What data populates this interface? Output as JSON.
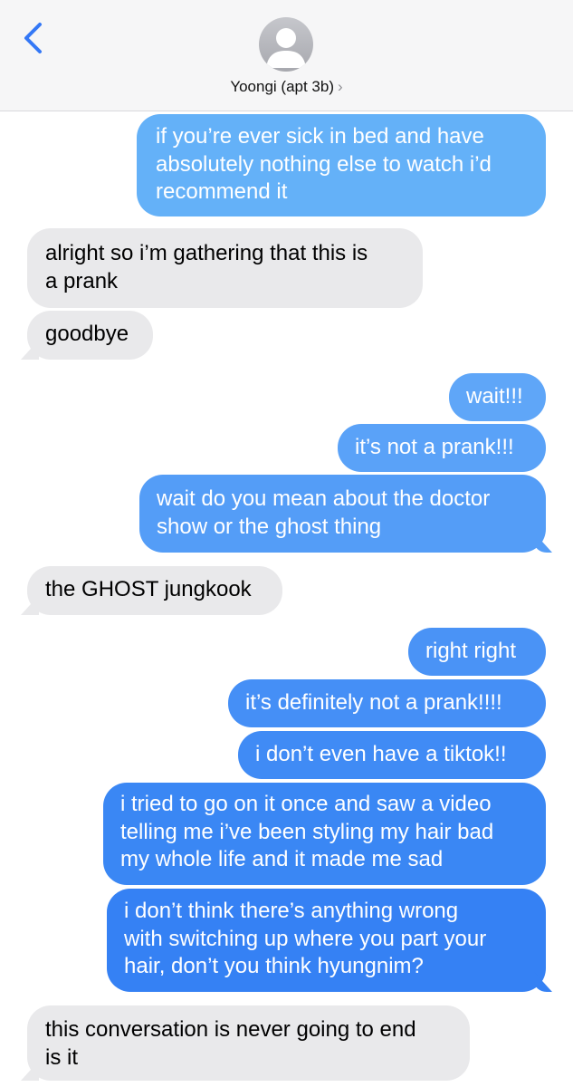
{
  "header": {
    "contact_name": "Yoongi (apt 3b)",
    "chevron": "›",
    "back_icon": "chevron-left-icon",
    "avatar_icon": "person-silhouette-icon",
    "accent_color": "#3478f6"
  },
  "messages": [
    {
      "from": "me",
      "text_lines": [
        "if you’re ever sick in bed and have",
        "absolutely nothing else to watch i’d",
        "recommend it"
      ]
    },
    {
      "from": "them",
      "text_lines": [
        "alright so i’m gathering that this is",
        "a prank"
      ]
    },
    {
      "from": "them",
      "text_lines": [
        "goodbye"
      ]
    },
    {
      "from": "me",
      "text_lines": [
        "wait!!!"
      ]
    },
    {
      "from": "me",
      "text_lines": [
        "it’s not a prank!!!"
      ]
    },
    {
      "from": "me",
      "text_lines": [
        "wait do you mean about the doctor",
        "show or the ghost thing"
      ]
    },
    {
      "from": "them",
      "text_lines": [
        "the GHOST jungkook"
      ]
    },
    {
      "from": "me",
      "text_lines": [
        "right right"
      ]
    },
    {
      "from": "me",
      "text_lines": [
        "it’s definitely not a prank!!!!"
      ]
    },
    {
      "from": "me",
      "text_lines": [
        "i don’t even have a tiktok!!"
      ]
    },
    {
      "from": "me",
      "text_lines": [
        "i tried to go on it once and saw a video",
        "telling me i’ve been styling my hair bad",
        "my whole life and it made me sad"
      ]
    },
    {
      "from": "me",
      "text_lines": [
        "i don’t think there’s anything wrong",
        "with switching up where you part your",
        "hair, don’t you think hyungnim?"
      ]
    },
    {
      "from": "them",
      "text_lines": [
        "this conversation is never going to end",
        "is it"
      ]
    }
  ]
}
